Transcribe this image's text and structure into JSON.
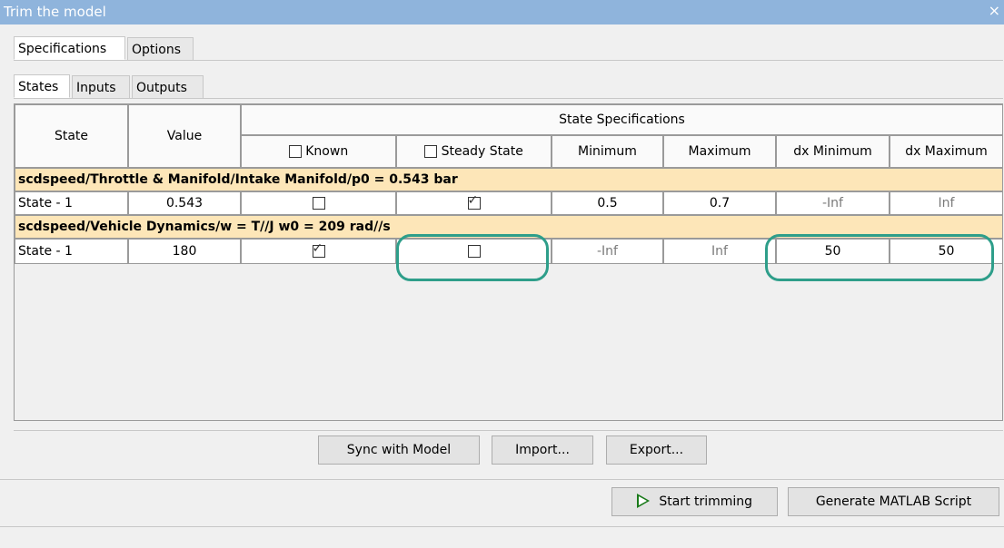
{
  "window": {
    "title": "Trim the model",
    "close_glyph": "×"
  },
  "tabs_top": [
    {
      "label": "Specifications"
    },
    {
      "label": "Options"
    }
  ],
  "tabs_sub": [
    {
      "label": "States"
    },
    {
      "label": "Inputs"
    },
    {
      "label": "Outputs"
    }
  ],
  "table": {
    "headers": {
      "state": "State",
      "value": "Value",
      "group": "State Specifications",
      "known": "Known",
      "steady": "Steady State",
      "minimum": "Minimum",
      "maximum": "Maximum",
      "dxmin": "dx Minimum",
      "dxmax": "dx Maximum"
    },
    "groups": [
      {
        "label": "scdspeed/Throttle & Manifold/Intake Manifold/p0 = 0.543 bar",
        "row": {
          "state": "State - 1",
          "value": "0.543",
          "known": false,
          "steady": true,
          "min": "0.5",
          "max": "0.7",
          "dxmin": "-Inf",
          "dxmax": "Inf"
        }
      },
      {
        "label": "scdspeed/Vehicle Dynamics/w = T//J w0 = 209 rad//s",
        "row": {
          "state": "State - 1",
          "value": "180",
          "known": true,
          "steady": false,
          "min": "-Inf",
          "max": "Inf",
          "dxmin": "50",
          "dxmax": "50"
        }
      }
    ]
  },
  "buttons": {
    "sync": "Sync with Model",
    "import": "Import...",
    "export": "Export...",
    "start": "Start trimming",
    "generate": "Generate MATLAB Script"
  },
  "check_glyph": "✓",
  "icons": {
    "play": "play-icon",
    "close": "close-icon"
  },
  "colors": {
    "title_bar": "#8fb4dc",
    "group_row": "#fde6b8",
    "highlight": "#2e9e8a",
    "play": "#1a7a1a"
  }
}
